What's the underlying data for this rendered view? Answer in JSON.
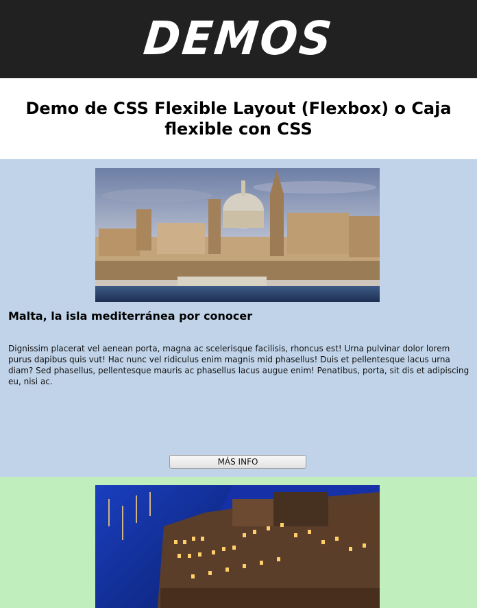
{
  "header": {
    "logo": "DEMOS"
  },
  "page": {
    "title": "Demo de CSS Flexible Layout (Flexbox) o Caja flexible con CSS"
  },
  "cards": [
    {
      "heading": "Malta, la isla mediterránea por conocer",
      "text": "Dignissim placerat vel aenean porta, magna ac scelerisque facilisis, rhoncus est! Urna pulvinar dolor lorem purus dapibus quis vut! Hac nunc vel ridiculus enim magnis mid phasellus! Duis et pellentesque lacus urna diam? Sed phasellus, pellentesque mauris ac phasellus lacus augue enim! Penatibus, porta, sit dis et adipiscing eu, nisi ac.",
      "button_label": "MÁS INFO",
      "background": "#c0d3e8"
    },
    {
      "background": "#c0eebd"
    }
  ],
  "colors": {
    "header_bg": "#212121",
    "header_text": "#ffffff"
  }
}
